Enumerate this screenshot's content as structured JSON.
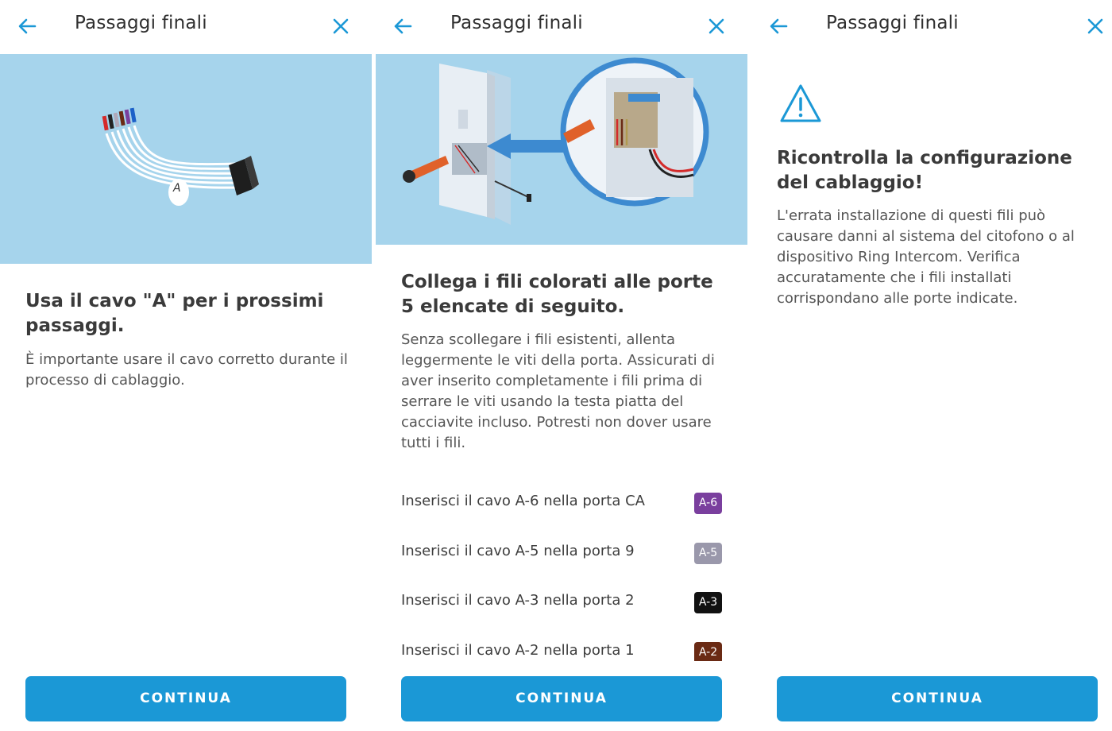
{
  "screens": [
    {
      "header": {
        "title": "Passaggi finali"
      },
      "hero": {
        "cable_letter": "A"
      },
      "heading": "Usa il cavo \"A\" per i prossimi passaggi.",
      "body": "È importante usare il cavo corretto durante il processo di cablaggio.",
      "button": "CONTINUA"
    },
    {
      "header": {
        "title": "Passaggi finali"
      },
      "heading": "Collega i fili colorati alle porte 5 elencate di seguito.",
      "body": "Senza scollegare i fili esistenti, allenta leggermente le viti della porta. Assicurati di aver inserito completamente i fili prima di serrare le viti usando la testa piatta del cacciavite incluso. Potresti non dover usare tutti i fili.",
      "steps": [
        {
          "label": "Inserisci il cavo A-6 nella porta CA",
          "badge": "A-6",
          "color": "#7a3f9e"
        },
        {
          "label": "Inserisci il cavo A-5 nella porta 9",
          "badge": "A-5",
          "color": "#9a98ab"
        },
        {
          "label": "Inserisci il cavo A-3 nella porta 2",
          "badge": "A-3",
          "color": "#111111"
        },
        {
          "label": "Inserisci il cavo A-2 nella porta 1",
          "badge": "A-2",
          "color": "#6a2a14"
        }
      ],
      "button": "CONTINUA"
    },
    {
      "header": {
        "title": "Passaggi finali"
      },
      "heading": "Ricontrolla la configurazione del cablaggio!",
      "body": "L'errata installazione di questi fili può causare danni al sistema del citofono o al dispositivo Ring Intercom. Verifica accuratamente che i fili installati corrispondano alle porte indicate.",
      "button": "CONTINUA"
    }
  ],
  "colors": {
    "accent": "#1b98d6",
    "hero_bg": "#a6d4ec"
  },
  "icons": {
    "back": "arrow-left-icon",
    "close": "close-icon",
    "warning": "warning-triangle-icon"
  }
}
